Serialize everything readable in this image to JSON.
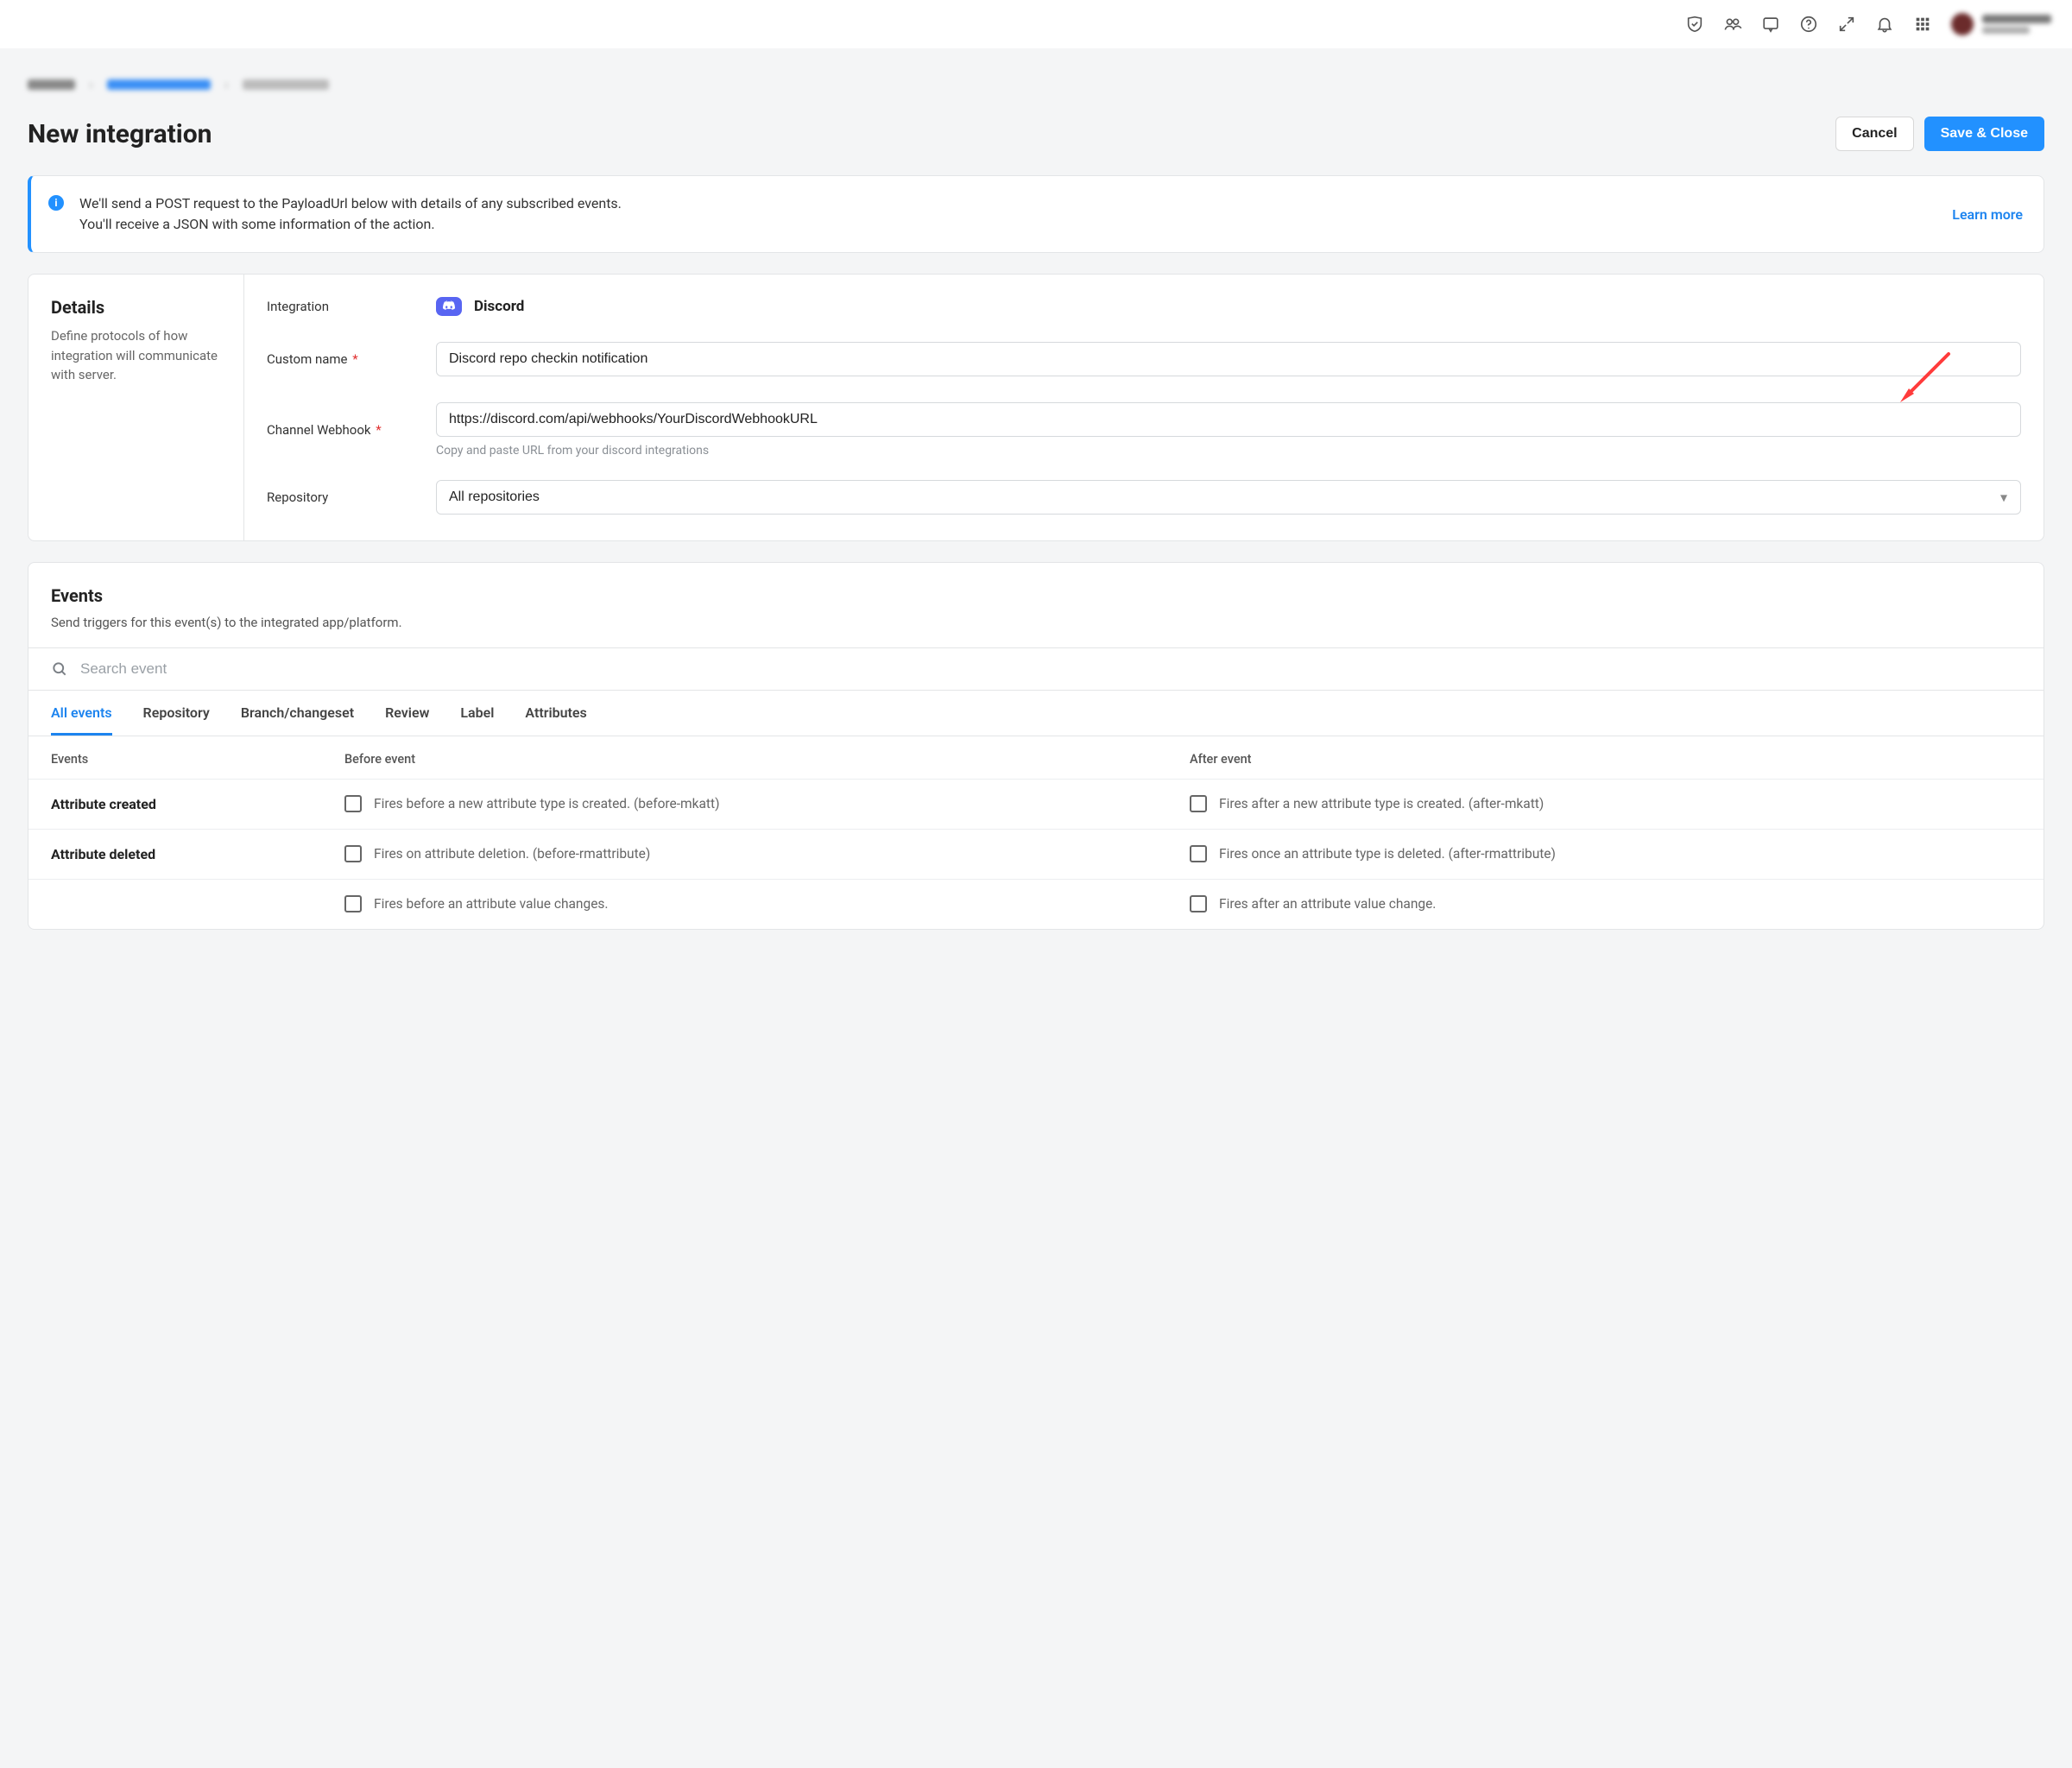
{
  "page_title": "New integration",
  "actions": {
    "cancel": "Cancel",
    "save": "Save & Close"
  },
  "banner": {
    "line1": "We'll send a POST request to the PayloadUrl below with details of any subscribed events.",
    "line2": "You'll receive a JSON with some information of the action.",
    "learn_more": "Learn more"
  },
  "details": {
    "heading": "Details",
    "description": "Define protocols of how integration will communicate with server.",
    "fields": {
      "integration_label": "Integration",
      "integration_value": "Discord",
      "custom_name_label": "Custom name",
      "custom_name_value": "Discord repo checkin notification",
      "webhook_label": "Channel Webhook",
      "webhook_value": "https://discord.com/api/webhooks/YourDiscordWebhookURL",
      "webhook_hint": "Copy and paste URL from your discord integrations",
      "repository_label": "Repository",
      "repository_value": "All repositories"
    }
  },
  "events": {
    "heading": "Events",
    "description": "Send triggers for this event(s) to the integrated app/platform.",
    "search_placeholder": "Search event",
    "tabs": [
      "All events",
      "Repository",
      "Branch/changeset",
      "Review",
      "Label",
      "Attributes"
    ],
    "active_tab": "All events",
    "columns": {
      "event": "Events",
      "before": "Before event",
      "after": "After event"
    },
    "rows": [
      {
        "name": "Attribute created",
        "before": "Fires before a new attribute type is created. (before-mkatt)",
        "after": "Fires after a new attribute type is created. (after-mkatt)"
      },
      {
        "name": "Attribute deleted",
        "before": "Fires on attribute deletion. (before-rmattribute)",
        "after": "Fires once an attribute type is deleted. (after-rmattribute)"
      },
      {
        "name": "",
        "before": "Fires before an attribute value changes.",
        "after": "Fires after an attribute value change."
      }
    ]
  }
}
